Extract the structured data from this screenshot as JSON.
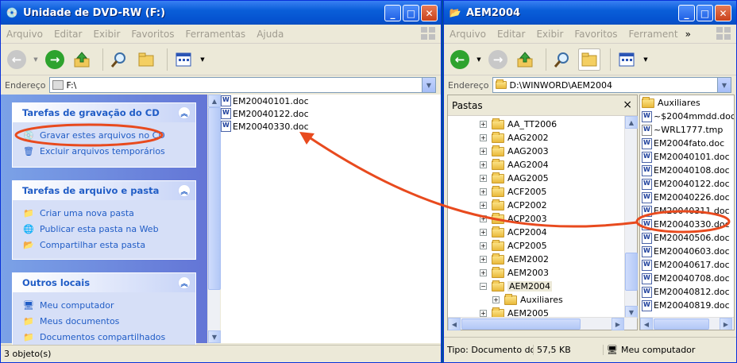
{
  "left_window": {
    "title": "Unidade de DVD-RW (F:)",
    "menu": [
      "Arquivo",
      "Editar",
      "Exibir",
      "Favoritos",
      "Ferramentas",
      "Ajuda"
    ],
    "address_label": "Endereço",
    "address": "F:\\",
    "tasks": [
      {
        "title": "Tarefas de gravação do CD",
        "items": [
          {
            "label": "Gravar estes arquivos no CD",
            "icon": "burn-cd-icon"
          },
          {
            "label": "Excluir arquivos temporários",
            "icon": "delete-temp-icon"
          }
        ]
      },
      {
        "title": "Tarefas de arquivo e pasta",
        "items": [
          {
            "label": "Criar uma nova pasta",
            "icon": "new-folder-icon"
          },
          {
            "label": "Publicar esta pasta na Web",
            "icon": "globe-icon"
          },
          {
            "label": "Compartilhar esta pasta",
            "icon": "share-folder-icon"
          }
        ]
      },
      {
        "title": "Outros locais",
        "items": [
          {
            "label": "Meu computador",
            "icon": "computer-icon"
          },
          {
            "label": "Meus documentos",
            "icon": "documents-icon"
          },
          {
            "label": "Documentos compartilhados",
            "icon": "shared-documents-icon"
          }
        ]
      }
    ],
    "files": [
      "EM20040101.doc",
      "EM20040122.doc",
      "EM20040330.doc"
    ],
    "status": "3 objeto(s)"
  },
  "right_window": {
    "title": "AEM2004",
    "menu": [
      "Arquivo",
      "Editar",
      "Exibir",
      "Favoritos",
      "Ferrament"
    ],
    "menu_more": "»",
    "address_label": "Endereço",
    "address": "D:\\WINWORD\\AEM2004",
    "folders_label": "Pastas",
    "close_glyph": "×",
    "tree": [
      {
        "label": "AA_TT2006",
        "expander": "+",
        "depth": 0
      },
      {
        "label": "AAG2002",
        "expander": "+",
        "depth": 0
      },
      {
        "label": "AAG2003",
        "expander": "+",
        "depth": 0
      },
      {
        "label": "AAG2004",
        "expander": "+",
        "depth": 0
      },
      {
        "label": "AAG2005",
        "expander": "+",
        "depth": 0
      },
      {
        "label": "ACF2005",
        "expander": "+",
        "depth": 0
      },
      {
        "label": "ACP2002",
        "expander": "+",
        "depth": 0
      },
      {
        "label": "ACP2003",
        "expander": "+",
        "depth": 0
      },
      {
        "label": "ACP2004",
        "expander": "+",
        "depth": 0
      },
      {
        "label": "ACP2005",
        "expander": "+",
        "depth": 0
      },
      {
        "label": "AEM2002",
        "expander": "+",
        "depth": 0
      },
      {
        "label": "AEM2003",
        "expander": "+",
        "depth": 0
      },
      {
        "label": "AEM2004",
        "expander": "−",
        "depth": 0,
        "selected": true
      },
      {
        "label": "Auxiliares",
        "expander": "+",
        "depth": 1
      },
      {
        "label": "AEM2005",
        "expander": "+",
        "depth": 0
      }
    ],
    "files": [
      {
        "name": "Auxiliares",
        "type": "folder"
      },
      {
        "name": "~$2004mmdd.doc",
        "type": "doc"
      },
      {
        "name": "~WRL1777.tmp",
        "type": "tmp"
      },
      {
        "name": "EM2004fato.doc",
        "type": "doc"
      },
      {
        "name": "EM20040101.doc",
        "type": "doc"
      },
      {
        "name": "EM20040108.doc",
        "type": "doc"
      },
      {
        "name": "EM20040122.doc",
        "type": "doc"
      },
      {
        "name": "EM20040226.doc",
        "type": "doc"
      },
      {
        "name": "EM20040311.doc",
        "type": "doc"
      },
      {
        "name": "EM20040330.doc",
        "type": "doc"
      },
      {
        "name": "EM20040506.doc",
        "type": "doc"
      },
      {
        "name": "EM20040603.doc",
        "type": "doc"
      },
      {
        "name": "EM20040617.doc",
        "type": "doc"
      },
      {
        "name": "EM20040708.doc",
        "type": "doc"
      },
      {
        "name": "EM20040812.doc",
        "type": "doc"
      },
      {
        "name": "EM20040819.doc",
        "type": "doc"
      }
    ],
    "status_type": "Tipo: Documento do Mici",
    "status_size": "57,5 KB",
    "status_location": "Meu computador"
  },
  "annotation_color": "#e84a1e"
}
